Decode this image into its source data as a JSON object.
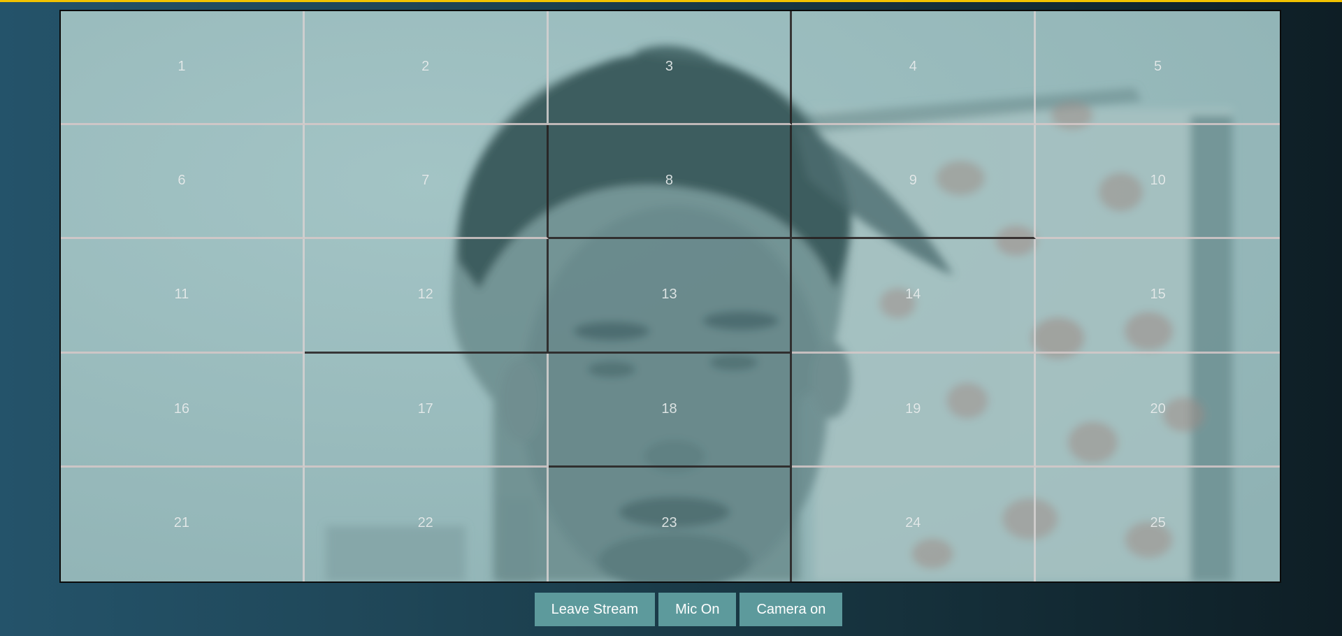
{
  "theme": {
    "accent": "#f2c200",
    "button_bg": "#5d9a9c",
    "grid_line_light": "#d6d2d2",
    "grid_line_dark": "#261e1e"
  },
  "video": {
    "grid_cells": [
      "1",
      "2",
      "3",
      "4",
      "5",
      "6",
      "7",
      "8",
      "9",
      "10",
      "11",
      "12",
      "13",
      "14",
      "15",
      "16",
      "17",
      "18",
      "19",
      "20",
      "21",
      "22",
      "23",
      "24",
      "25"
    ]
  },
  "controls": {
    "leave_label": "Leave Stream",
    "mic_label": "Mic On",
    "camera_label": "Camera on"
  }
}
